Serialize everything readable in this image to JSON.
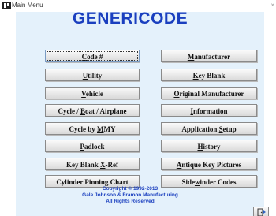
{
  "window": {
    "title": "Main Menu",
    "close_glyph": "×"
  },
  "app": {
    "title": "GENERICODE"
  },
  "buttons_left": [
    {
      "label": "Code #",
      "focused": true
    },
    {
      "label": "Utility"
    },
    {
      "label": "Vehicle"
    },
    {
      "label": "Cycle / Boat / Airplane"
    },
    {
      "label": "Cycle by MMY"
    },
    {
      "label": "Padlock"
    },
    {
      "label": "Key Blank X-Ref"
    },
    {
      "label": "Cylinder Pinning Chart"
    }
  ],
  "buttons_right": [
    {
      "label": "Manufacturer"
    },
    {
      "label": "Key Blank"
    },
    {
      "label": "Original Manufacturer"
    },
    {
      "label": "Information"
    },
    {
      "label": "Application Setup"
    },
    {
      "label": "History"
    },
    {
      "label": "Antique Key Pictures"
    },
    {
      "label": "Sidewinder Codes"
    }
  ],
  "footer": {
    "line1": "Copyright © 1992-2013",
    "line2": "Gale Johnson & Framon Manufacturing",
    "line3": "All Rights Reserved"
  },
  "icons": {
    "app": "key-window-icon",
    "exit": "exit-door-icon"
  }
}
